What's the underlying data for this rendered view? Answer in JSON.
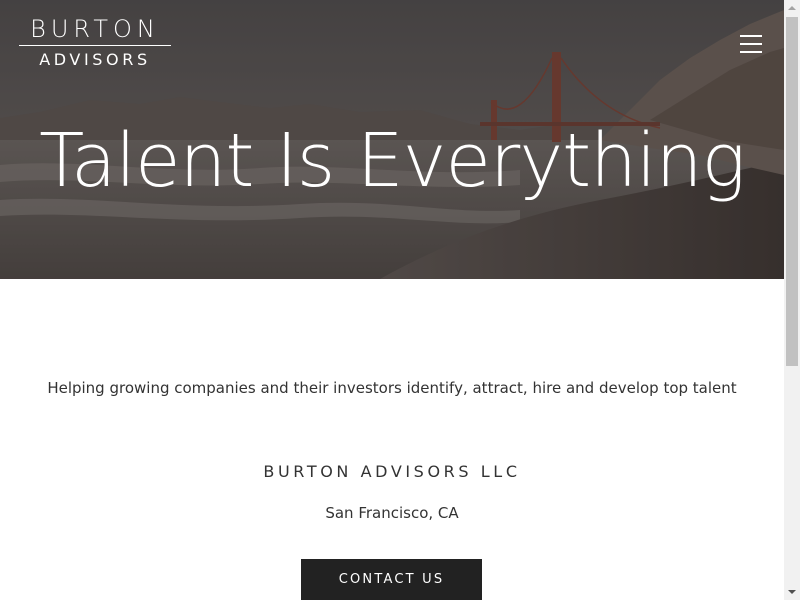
{
  "header": {
    "logo_top": "BURTON",
    "logo_bottom": "ADVISORS",
    "menu_icon": "hamburger-menu-icon"
  },
  "hero": {
    "title": "Talent Is Everything"
  },
  "content": {
    "tagline": "Helping growing companies and their investors identify, attract, hire and develop top talent",
    "company_name": "BURTON ADVISORS LLC",
    "location": "San Francisco, CA",
    "contact_button_label": "CONTACT US"
  },
  "colors": {
    "button_background": "#222222",
    "text": "#333333",
    "hero_overlay": "#4a4644"
  },
  "scrollbar": {
    "up_icon": "scroll-up-arrow-icon",
    "down_icon": "scroll-down-arrow-icon"
  }
}
